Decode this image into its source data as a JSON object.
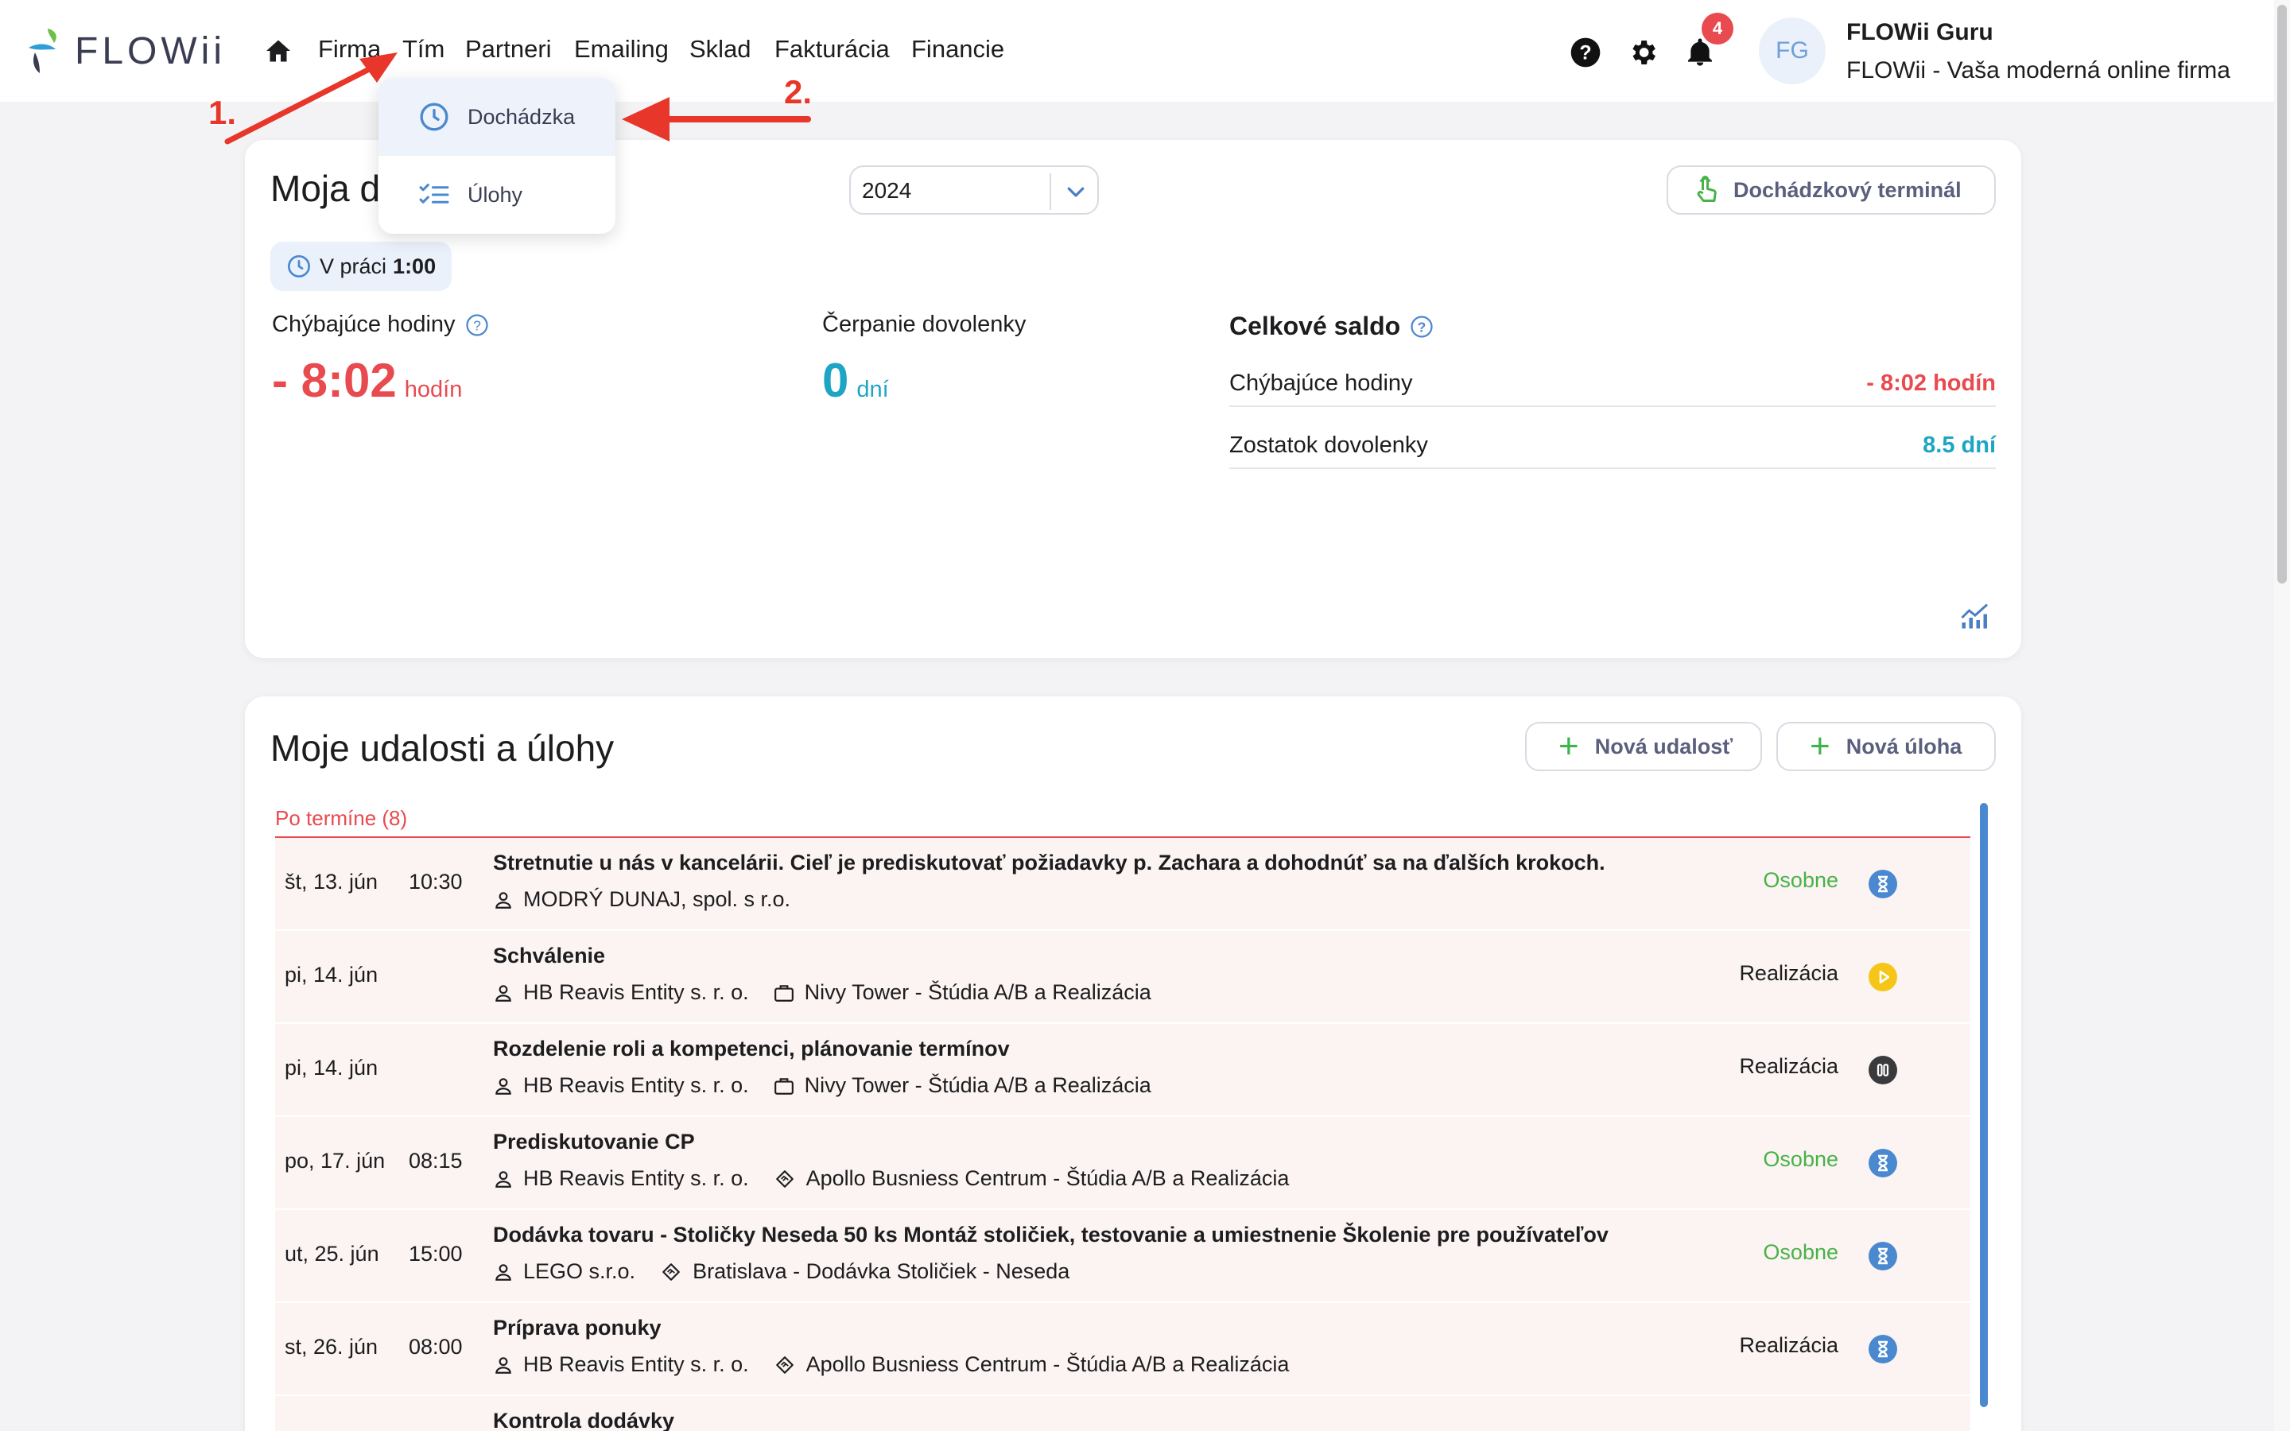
{
  "header": {
    "logo_text": "FLOWii",
    "nav": [
      "Firma",
      "Tím",
      "Partneri",
      "Emailing",
      "Sklad",
      "Fakturácia",
      "Financie"
    ],
    "notifications_count": "4",
    "avatar_initials": "FG",
    "user_name": "FLOWii Guru",
    "user_company": "FLOWii - Vaša moderná online firma"
  },
  "dropdown": {
    "items": [
      {
        "label": "Dochádzka",
        "icon": "clock-icon",
        "active": true
      },
      {
        "label": "Úlohy",
        "icon": "checklist-icon",
        "active": false
      }
    ]
  },
  "annotations": {
    "step1": "1.",
    "step2": "2."
  },
  "attendance": {
    "title_visible": "Moja d",
    "date_value": "2024",
    "terminal_button": "Dochádzkový terminál",
    "in_work_label": "V práci",
    "in_work_value": "1:00",
    "missing_label": "Chýbajúce hodiny",
    "missing_value": "- 8:02",
    "missing_unit": "hodín",
    "vacation_label": "Čerpanie dovolenky",
    "vacation_value": "0",
    "vacation_unit": "dní",
    "saldo_title": "Celkové saldo",
    "saldo_rows": [
      {
        "label": "Chýbajúce hodiny",
        "value": "- 8:02 hodín"
      },
      {
        "label": "Zostatok dovolenky",
        "value": "8.5 dní"
      }
    ]
  },
  "events": {
    "title": "Moje udalosti a úlohy",
    "new_event_button": "Nová udalosť",
    "new_task_button": "Nová úloha",
    "group_label": "Po termíne (8)",
    "rows": [
      {
        "date": "št, 13. jún",
        "time": "10:30",
        "title": "Stretnutie u nás v kancelárii. Cieľ je prediskutovať požiadavky p. Zachara a dohodnúť sa na ďalších krokoch.",
        "contact": "MODRÝ DUNAJ, spol. s r.o.",
        "project": "",
        "project_icon": "",
        "category": "Osobne",
        "status_icon": "hourglass-icon"
      },
      {
        "date": "pi, 14. jún",
        "time": "",
        "title": "Schválenie",
        "contact": "HB Reavis Entity s. r. o.",
        "project": "Nivy Tower - Štúdia A/B a Realizácia",
        "project_icon": "briefcase-icon",
        "category": "Realizácia",
        "status_icon": "play-icon"
      },
      {
        "date": "pi, 14. jún",
        "time": "",
        "title": "Rozdelenie roli a kompetenci, plánovanie termínov",
        "contact": "HB Reavis Entity s. r. o.",
        "project": "Nivy Tower - Štúdia A/B a Realizácia",
        "project_icon": "briefcase-icon",
        "category": "Realizácia",
        "status_icon": "pause-icon"
      },
      {
        "date": "po, 17. jún",
        "time": "08:15",
        "title": "Prediskutovanie CP",
        "contact": "HB Reavis Entity s. r. o.",
        "project": "Apollo Busniess Centrum - Štúdia A/B a Realizácia",
        "project_icon": "handshake-icon",
        "category": "Osobne",
        "status_icon": "hourglass-icon"
      },
      {
        "date": "ut, 25. jún",
        "time": "15:00",
        "title": "Dodávka tovaru - Stoličky Neseda 50 ks Montáž stoličiek, testovanie a umiestnenie Školenie pre používateľov",
        "contact": "LEGO s.r.o.",
        "project": "Bratislava - Dodávka Stoličiek - Neseda",
        "project_icon": "handshake-icon",
        "category": "Osobne",
        "status_icon": "hourglass-icon"
      },
      {
        "date": "st, 26. jún",
        "time": "08:00",
        "title": "Príprava ponuky",
        "contact": "HB Reavis Entity s. r. o.",
        "project": "Apollo Busniess Centrum - Štúdia A/B a Realizácia",
        "project_icon": "handshake-icon",
        "category": "Realizácia",
        "status_icon": "hourglass-icon"
      },
      {
        "date": "",
        "time": "",
        "title": "Kontrola dodávky",
        "contact": "",
        "project": "",
        "project_icon": "",
        "category": "",
        "status_icon": ""
      }
    ]
  },
  "colors": {
    "accent_red": "#e84a4f",
    "accent_teal": "#1ea5c4",
    "status_green": "#48b248",
    "status_blue": "#4a88d0",
    "status_yellow": "#f5c518",
    "annotation_red": "#e8362a"
  }
}
